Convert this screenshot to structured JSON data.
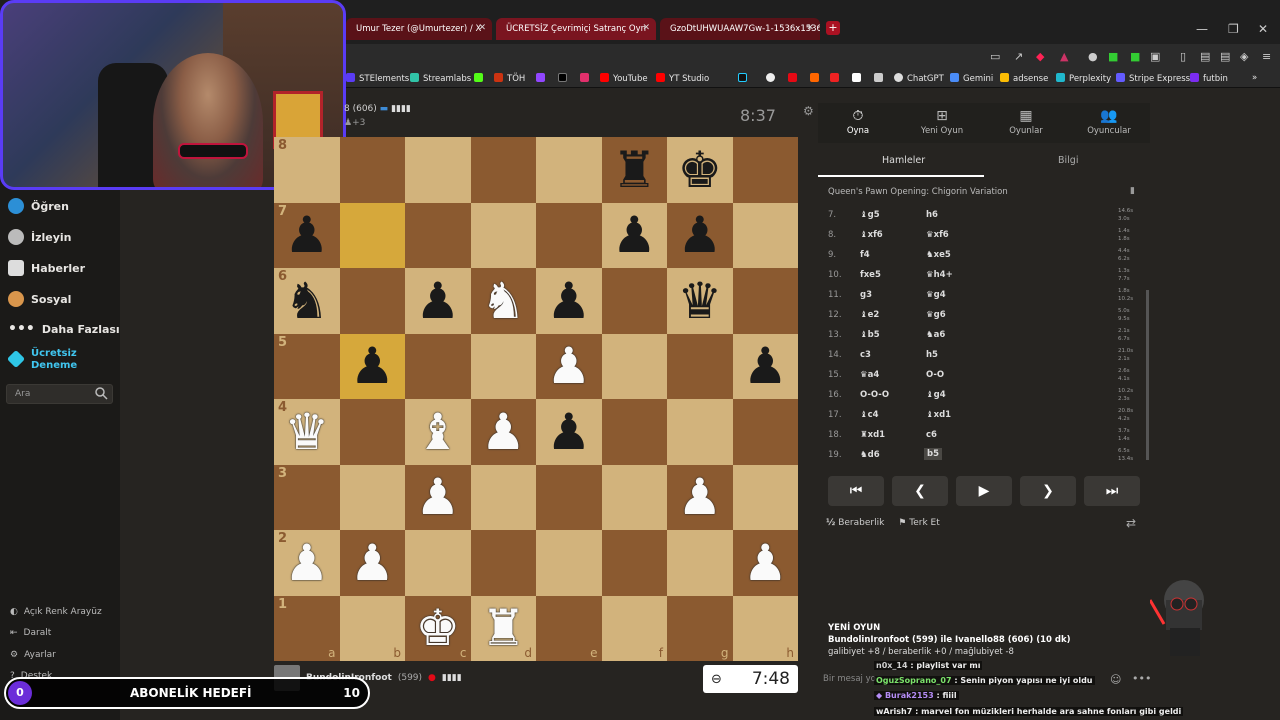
{
  "browser": {
    "tabs": [
      {
        "label": "Umur Tezer (@Umurtezer) / X"
      },
      {
        "label": "ÜCRETSİZ Çevrimiçi Satranç Oyn"
      },
      {
        "label": "GzoDtUHWUAAW7Gw-1-1536x1536"
      }
    ],
    "bookmarks": [
      "STElements",
      "Streamlabs",
      "TÖH",
      "YouTube",
      "YT Studio",
      "ChatGPT",
      "Gemini",
      "adsense",
      "Perplexity",
      "Stripe Express",
      "futbin"
    ]
  },
  "sidebar": {
    "items": [
      {
        "label": "Öğren",
        "icon": "graduation-icon"
      },
      {
        "label": "İzleyin",
        "icon": "binoculars-icon"
      },
      {
        "label": "Haberler",
        "icon": "news-icon"
      },
      {
        "label": "Sosyal",
        "icon": "social-icon"
      },
      {
        "label": "Daha Fazlası",
        "icon": "more-icon"
      },
      {
        "label": "Ücretsiz",
        "label2": "Deneme",
        "icon": "diamond-icon"
      }
    ],
    "search_placeholder": "Ara",
    "bottom": [
      {
        "label": "Açık Renk Arayüz"
      },
      {
        "label": "Daralt"
      },
      {
        "label": "Ayarlar"
      },
      {
        "label": "Destek"
      }
    ]
  },
  "game": {
    "top_player": {
      "name": "8 (606)",
      "extra": "+3",
      "clock": "8:37"
    },
    "bottom_player": {
      "name": "BundolinIronfoot",
      "rating": "(599)",
      "clock": "7:48"
    },
    "files": [
      "a",
      "b",
      "c",
      "d",
      "e",
      "f",
      "g",
      "h"
    ],
    "ranks": [
      "8",
      "7",
      "6",
      "5",
      "4",
      "3",
      "2",
      "1"
    ],
    "board": [
      [
        "",
        "",
        "",
        "",
        "",
        "bR",
        "bK",
        ""
      ],
      [
        "bP",
        "",
        "",
        "",
        "",
        "bP",
        "bP",
        ""
      ],
      [
        "bN",
        "",
        "bP",
        "wN",
        "bP",
        "",
        "bQ",
        ""
      ],
      [
        "",
        "bP",
        "",
        "",
        "wP",
        "",
        "",
        "bP"
      ],
      [
        "wQ",
        "",
        "wB",
        "wP",
        "bP",
        "",
        "",
        ""
      ],
      [
        "",
        "",
        "wP",
        "",
        "",
        "",
        "wP",
        ""
      ],
      [
        "wP",
        "wP",
        "",
        "",
        "",
        "",
        "",
        "wP"
      ],
      [
        "",
        "",
        "wK",
        "wR",
        "",
        "",
        "",
        ""
      ]
    ],
    "highlight": [
      [
        1,
        1
      ],
      [
        3,
        1
      ]
    ]
  },
  "panel": {
    "tabs": [
      {
        "label": "Oyna",
        "icon": "clock-icon"
      },
      {
        "label": "Yeni Oyun",
        "icon": "plus-icon"
      },
      {
        "label": "Oyunlar",
        "icon": "board-icon"
      },
      {
        "label": "Oyuncular",
        "icon": "players-icon"
      }
    ],
    "subtabs": [
      "Hamleler",
      "Bilgi"
    ],
    "opening": "Queen's Pawn Opening: Chigorin Variation",
    "moves": [
      {
        "n": "7.",
        "w": "♝g5",
        "b": "h6",
        "t1": "14.6s",
        "t2": "3.0s"
      },
      {
        "n": "8.",
        "w": "♝xf6",
        "b": "♛xf6",
        "t1": "1.4s",
        "t2": "1.8s"
      },
      {
        "n": "9.",
        "w": "f4",
        "b": "♞xe5",
        "t1": "4.4s",
        "t2": "6.2s"
      },
      {
        "n": "10.",
        "w": "fxe5",
        "b": "♛h4+",
        "t1": "1.3s",
        "t2": "7.7s"
      },
      {
        "n": "11.",
        "w": "g3",
        "b": "♛g4",
        "t1": "1.8s",
        "t2": "10.2s"
      },
      {
        "n": "12.",
        "w": "♝e2",
        "b": "♛g6",
        "t1": "5.0s",
        "t2": "9.5s"
      },
      {
        "n": "13.",
        "w": "♝b5",
        "b": "♞a6",
        "t1": "2.1s",
        "t2": "6.7s"
      },
      {
        "n": "14.",
        "w": "c3",
        "b": "h5",
        "t1": "21.0s",
        "t2": "2.1s"
      },
      {
        "n": "15.",
        "w": "♛a4",
        "b": "O-O",
        "t1": "2.6s",
        "t2": "4.1s"
      },
      {
        "n": "16.",
        "w": "O-O-O",
        "b": "♝g4",
        "t1": "10.2s",
        "t2": "2.3s"
      },
      {
        "n": "17.",
        "w": "♝c4",
        "b": "♝xd1",
        "t1": "20.8s",
        "t2": "4.2s"
      },
      {
        "n": "18.",
        "w": "♜xd1",
        "b": "c6",
        "t1": "3.7s",
        "t2": "1.4s"
      },
      {
        "n": "19.",
        "w": "♞d6",
        "b": "b5",
        "t1": "6.5s",
        "t2": "13.4s"
      }
    ],
    "actions": {
      "draw": "Beraberlik",
      "resign": "Terk Et"
    },
    "new_game": {
      "title": "YENİ OYUN",
      "line1": "BundolinIronfoot (599) ile Ivanello88 (606) (10 dk)",
      "line2": "galibiyet +8 / beraberlik +0 / mağlubiyet -8"
    },
    "chat_placeholder": "Bir mesaj yo"
  },
  "chat": [
    {
      "user": "n0x_14",
      "msg": "playlist var mı",
      "color": "#cfcfcf"
    },
    {
      "user": "OguzSoprano_07",
      "msg": "Senin piyon yapısı ne iyi oldu",
      "color": "#7ce36b"
    },
    {
      "user": "Burak2153",
      "msg": "fiiil",
      "color": "#b48cf5"
    },
    {
      "user": "wArish7",
      "msg": "marvel fon müzikleri herhalde ara sahne fonları gibi geldi",
      "color": "#e0e0e0"
    }
  ],
  "subgoal": {
    "current": "0",
    "label": "ABONELİK HEDEFİ",
    "target": "10"
  },
  "colors": {
    "accent": "#5a3cf5",
    "board_light": "#d2b37c",
    "board_dark": "#8b5a30"
  }
}
